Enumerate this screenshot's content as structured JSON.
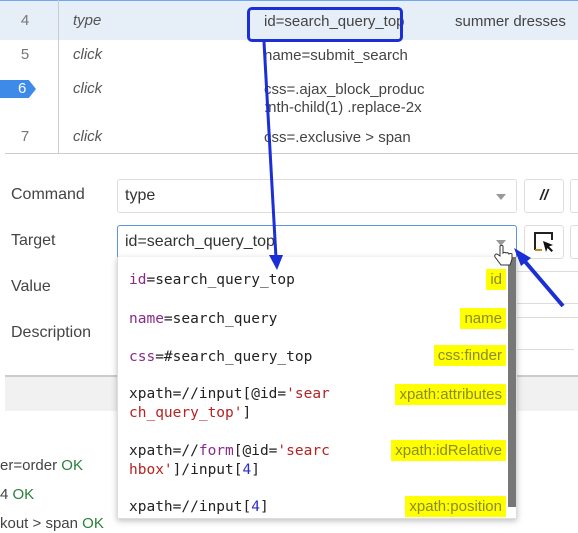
{
  "table": {
    "rows": [
      {
        "num": "4",
        "command": "type",
        "target": "id=search_query_top",
        "value": "summer dresses",
        "selected": true
      },
      {
        "num": "5",
        "command": "click",
        "target": "name=submit_search",
        "value": ""
      },
      {
        "num": "6",
        "command": "click",
        "target_line1": "css=.ajax_block_produc",
        "target_line2": ":nth-child(1) .replace-2x",
        "value": "",
        "breakpoint": true
      },
      {
        "num": "7",
        "command": "click",
        "target": "css=.exclusive > span",
        "value": ""
      }
    ]
  },
  "form": {
    "command_label": "Command",
    "command_value": "type",
    "comment_button": "//",
    "target_label": "Target",
    "target_value": "id=search_query_top",
    "value_label": "Value",
    "description_label": "Description"
  },
  "dropdown": {
    "items": [
      {
        "key": "id",
        "rest": "=search_query_top",
        "badge": "id"
      },
      {
        "key": "name",
        "rest": "=search_query",
        "badge": "name"
      },
      {
        "key": "css",
        "rest": "=#search_query_top",
        "badge": "css:finder"
      },
      {
        "badge": "xpath:attributes"
      },
      {
        "badge": "xpath:idRelative"
      },
      {
        "badge": "xpath:position"
      }
    ]
  },
  "log": {
    "lines": [
      {
        "text": "er=order",
        "status": "OK"
      },
      {
        "text": "4",
        "status": "OK"
      },
      {
        "text": "kout > span",
        "status": "OK"
      }
    ]
  },
  "colors": {
    "annotation": "#1b2fd6",
    "badge": "#ffff00",
    "selected_row": "#e6eef8",
    "ok": "#2a7f3a"
  }
}
